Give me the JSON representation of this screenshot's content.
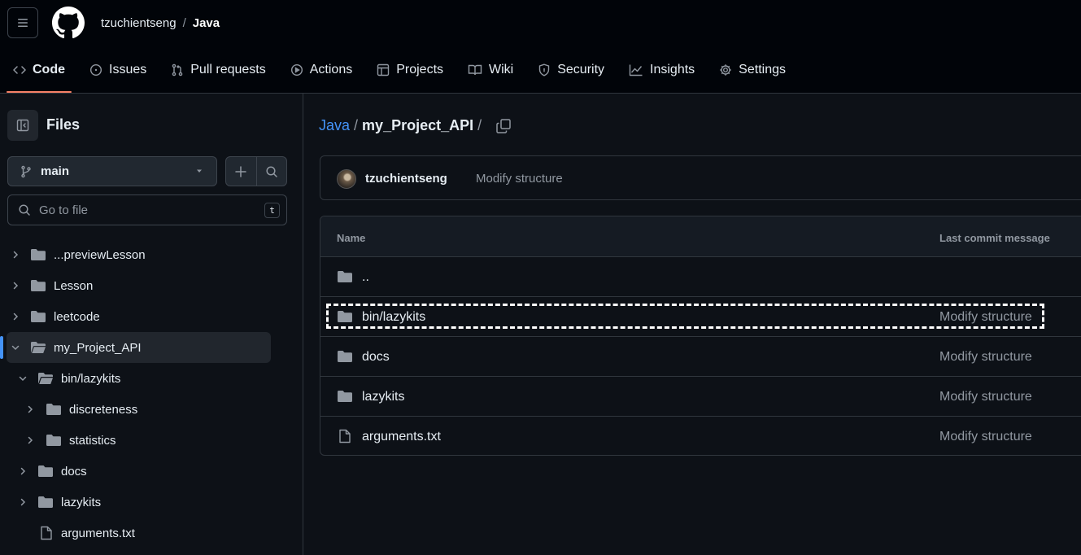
{
  "header": {
    "owner": "tzuchientseng",
    "separator": "/",
    "repo": "Java"
  },
  "tabs": [
    {
      "label": "Code",
      "icon": "code-icon",
      "active": true
    },
    {
      "label": "Issues",
      "icon": "issue-opened-icon"
    },
    {
      "label": "Pull requests",
      "icon": "git-pull-request-icon"
    },
    {
      "label": "Actions",
      "icon": "play-icon"
    },
    {
      "label": "Projects",
      "icon": "table-icon"
    },
    {
      "label": "Wiki",
      "icon": "book-icon"
    },
    {
      "label": "Security",
      "icon": "shield-icon"
    },
    {
      "label": "Insights",
      "icon": "graph-icon"
    },
    {
      "label": "Settings",
      "icon": "gear-icon"
    }
  ],
  "sidebar": {
    "title": "Files",
    "branch": "main",
    "search_placeholder": "Go to file",
    "search_shortcut": "t",
    "tree": [
      {
        "label": "...previewLesson",
        "type": "folder",
        "depth": 0,
        "expanded": false
      },
      {
        "label": "Lesson",
        "type": "folder",
        "depth": 0,
        "expanded": false
      },
      {
        "label": "leetcode",
        "type": "folder",
        "depth": 0,
        "expanded": false
      },
      {
        "label": "my_Project_API",
        "type": "folder",
        "depth": 0,
        "expanded": true,
        "selected": true
      },
      {
        "label": "bin/lazykits",
        "type": "folder",
        "depth": 1,
        "expanded": true
      },
      {
        "label": "discreteness",
        "type": "folder",
        "depth": 2,
        "expanded": false
      },
      {
        "label": "statistics",
        "type": "folder",
        "depth": 2,
        "expanded": false
      },
      {
        "label": "docs",
        "type": "folder",
        "depth": 1,
        "expanded": false
      },
      {
        "label": "lazykits",
        "type": "folder",
        "depth": 1,
        "expanded": false
      },
      {
        "label": "arguments.txt",
        "type": "file",
        "depth": 1
      }
    ]
  },
  "main": {
    "path_root": "Java",
    "path_sep": "/",
    "path_current": "my_Project_API",
    "path_trailing": "/",
    "commit": {
      "author": "tzuchientseng",
      "message": "Modify structure"
    },
    "table": {
      "col_name": "Name",
      "col_message": "Last commit message",
      "rows": [
        {
          "name": "..",
          "type": "folder",
          "message": ""
        },
        {
          "name": "bin/lazykits",
          "type": "folder",
          "message": "Modify structure"
        },
        {
          "name": "docs",
          "type": "folder",
          "message": "Modify structure"
        },
        {
          "name": "lazykits",
          "type": "folder",
          "message": "Modify structure"
        },
        {
          "name": "arguments.txt",
          "type": "file",
          "message": "Modify structure"
        }
      ]
    }
  },
  "colors": {
    "background": "#0d1117",
    "header_bg": "#010409",
    "accent_link": "#4493f8",
    "tab_underline": "#f78166",
    "muted_text": "#9198a1"
  }
}
